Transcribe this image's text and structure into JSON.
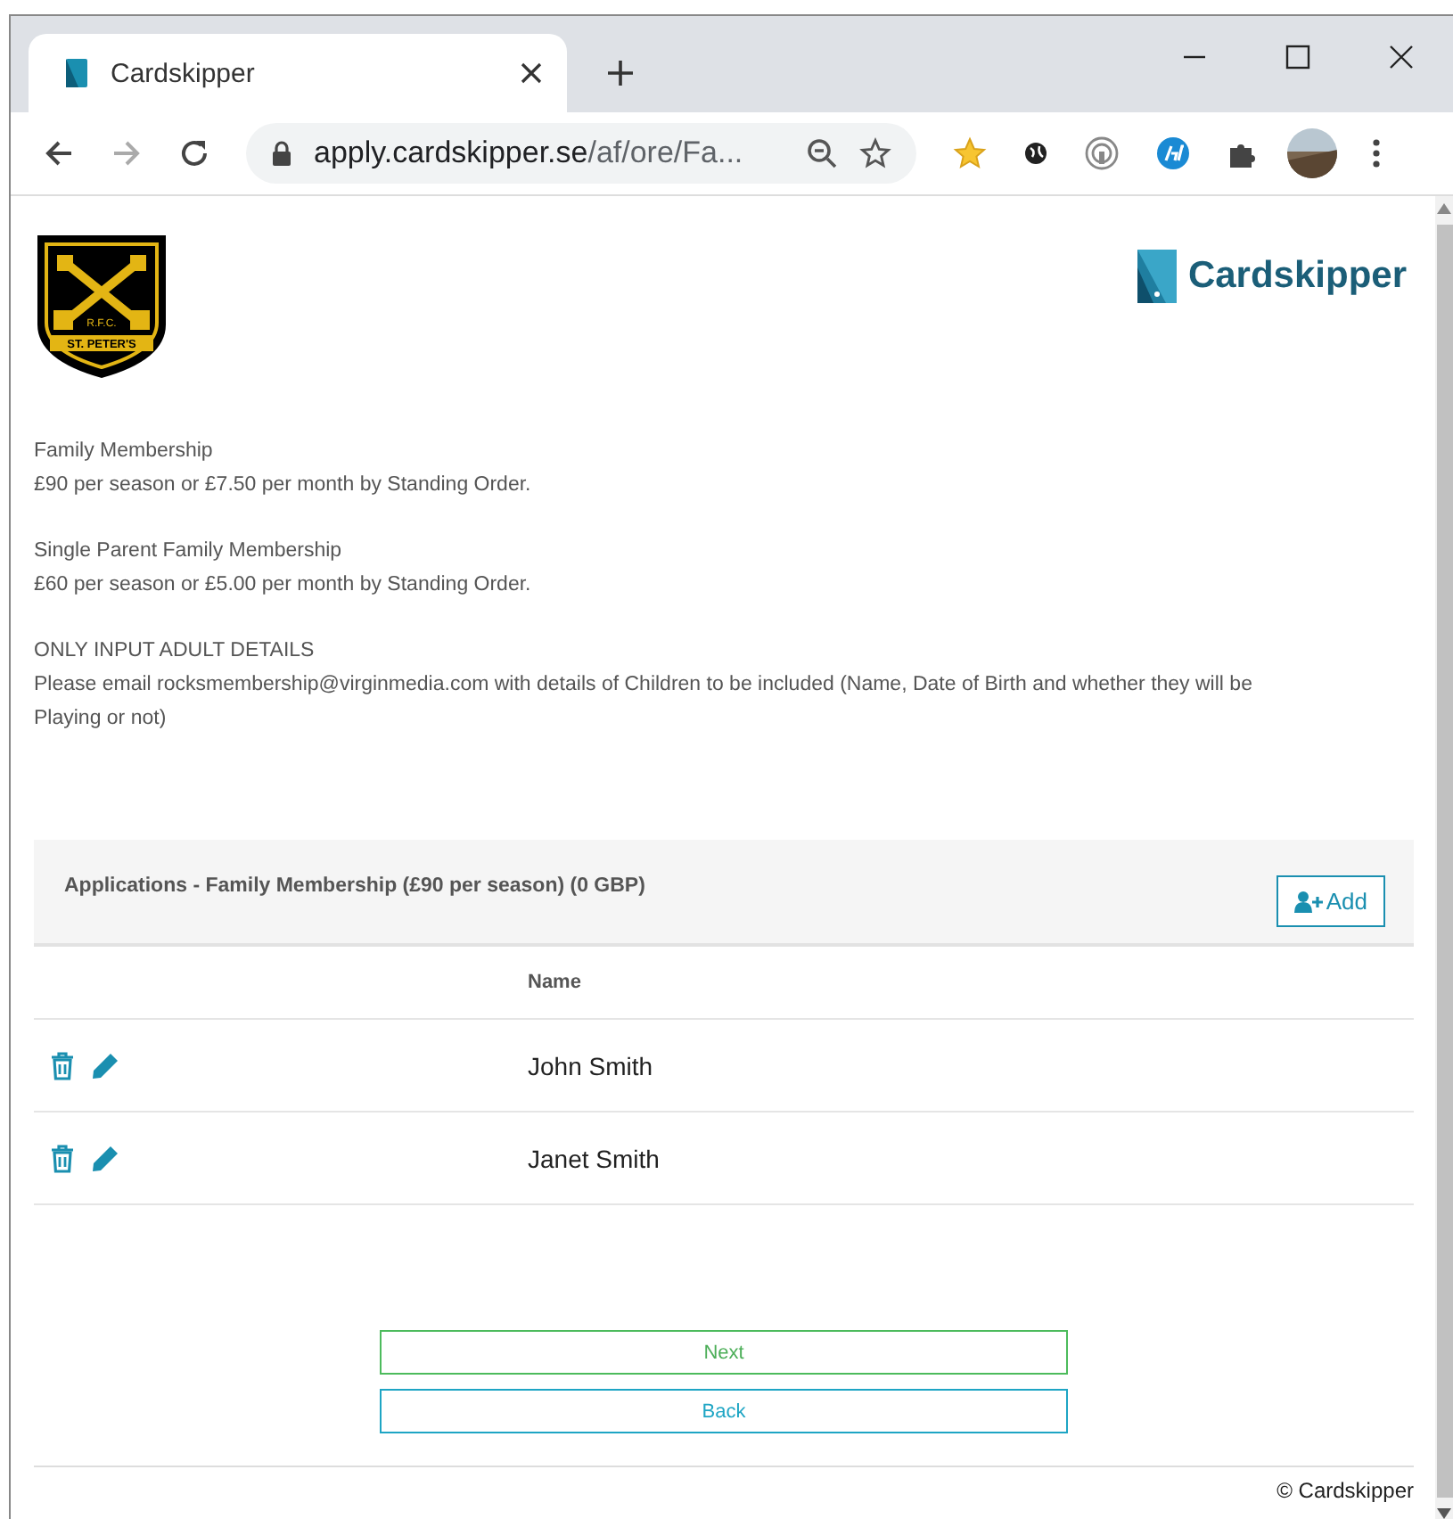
{
  "browser": {
    "tab": {
      "title": "Cardskipper",
      "selected": true
    },
    "address": {
      "domain": "apply.cardskipper.se",
      "path": "/af/ore/Fa..."
    }
  },
  "crest": {
    "line_1": "R.F.C.",
    "line_2": "ST. PETER'S"
  },
  "brand": {
    "name": "Cardskipper"
  },
  "info": [
    {
      "title": "Family Membership",
      "text": "£90 per season or £7.50 per month by Standing Order."
    },
    {
      "title": "Single Parent Family Membership",
      "text": "£60 per season or £5.00 per month by Standing Order."
    },
    {
      "title": "ONLY INPUT ADULT DETAILS",
      "text": "Please email rocksmembership@virginmedia.com with details of Children to be included (Name, Date of Birth and whether they will be Playing or not)"
    }
  ],
  "applications": {
    "title": "Applications - Family Membership (£90 per season) (0 GBP)",
    "add_label": "Add",
    "columns": [
      "Name"
    ],
    "rows": [
      {
        "name": "John Smith"
      },
      {
        "name": "Janet Smith"
      }
    ]
  },
  "buttons": [
    {
      "kind": "primary",
      "label": "Next"
    },
    {
      "kind": "secondary",
      "label": "Back"
    }
  ],
  "footer": "© Cardskipper"
}
